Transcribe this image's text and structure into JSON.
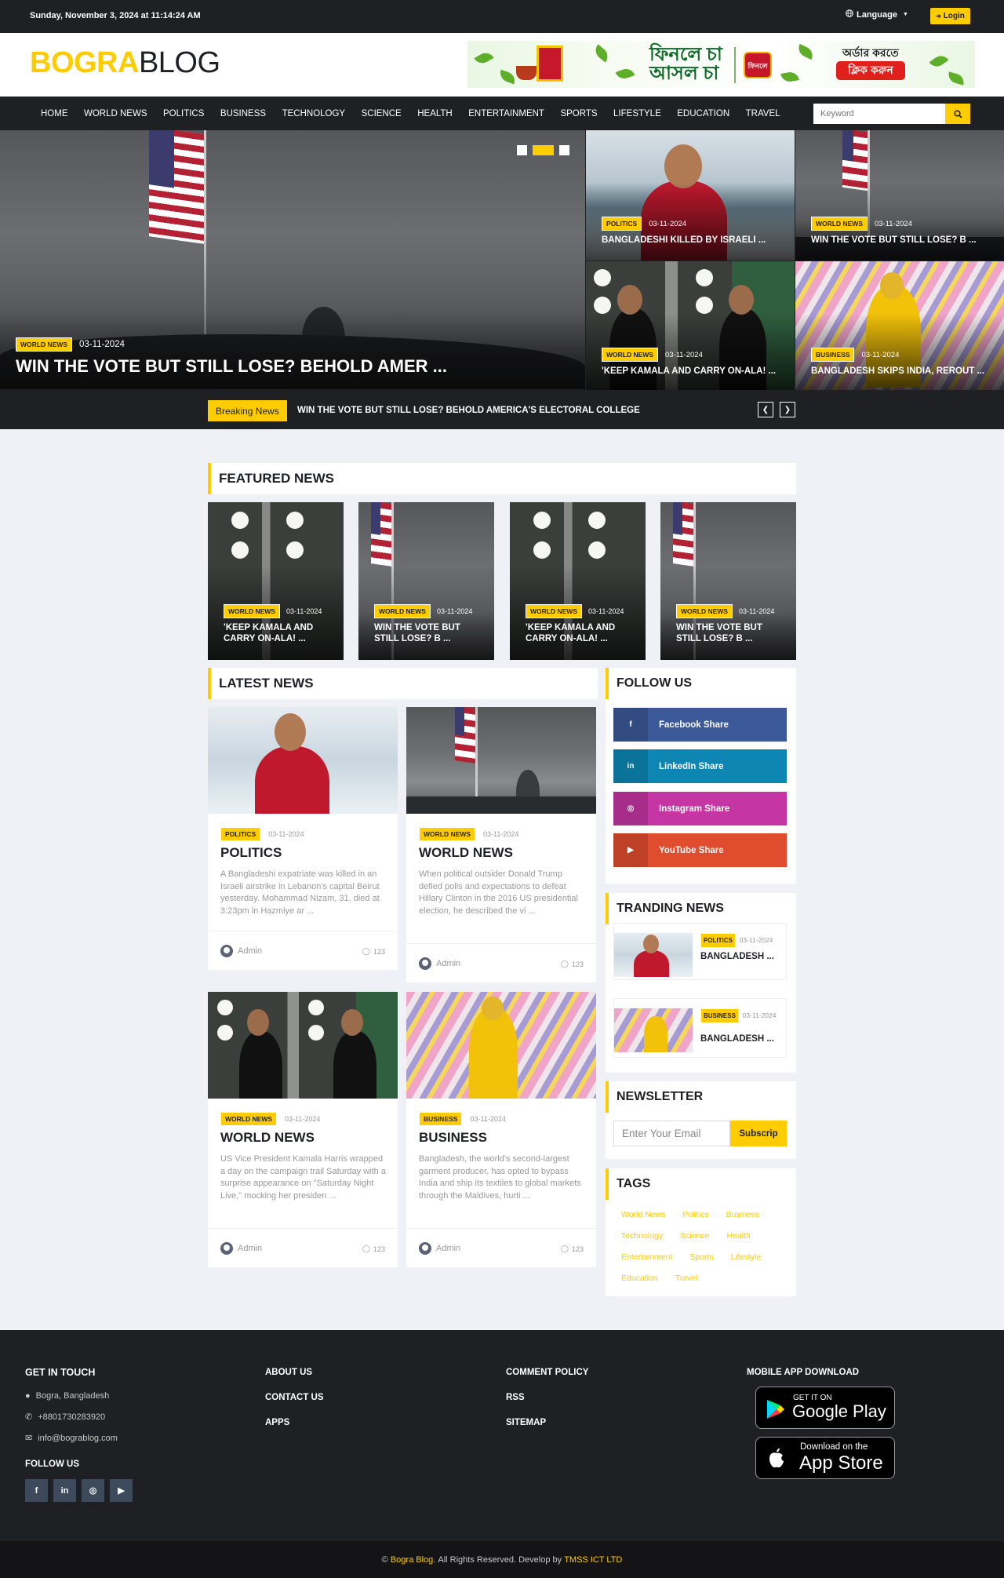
{
  "topbar": {
    "date": "Sunday, November 3, 2024 at 11:14:24 AM",
    "language": "Language",
    "login": "Login"
  },
  "header": {
    "logo_a": "BOGRA",
    "logo_b": "BLOG",
    "ad": {
      "line1": "ফিনলে চা",
      "line2": "আসল চা",
      "brand": "ফিনলে",
      "cta_top": "অর্ডার করতে",
      "cta": "ক্লিক করুন"
    }
  },
  "nav": {
    "items": [
      "HOME",
      "WORLD NEWS",
      "POLITICS",
      "BUSINESS",
      "TECHNOLOGY",
      "SCIENCE",
      "HEALTH",
      "ENTERTAINMENT",
      "SPORTS",
      "LIFESTYLE",
      "EDUCATION",
      "TRAVEL"
    ],
    "search_placeholder": "Keyword"
  },
  "hero": {
    "main": {
      "category": "WORLD NEWS",
      "date": "03-11-2024",
      "title": "WIN THE VOTE BUT STILL LOSE? BEHOLD AMER ..."
    },
    "side": [
      {
        "category": "POLITICS",
        "date": "03-11-2024",
        "title": "BANGLADESHI KILLED BY ISRAELI ..."
      },
      {
        "category": "WORLD NEWS",
        "date": "03-11-2024",
        "title": "WIN THE VOTE BUT STILL LOSE? B ..."
      },
      {
        "category": "WORLD NEWS",
        "date": "03-11-2024",
        "title": "'KEEP KAMALA AND CARRY ON-ALA! ..."
      },
      {
        "category": "BUSINESS",
        "date": "03-11-2024",
        "title": "BANGLADESH SKIPS INDIA, REROUT ..."
      }
    ],
    "breaking_label": "Breaking News",
    "breaking_text": "WIN THE VOTE BUT STILL LOSE? BEHOLD AMERICA'S ELECTORAL COLLEGE"
  },
  "featured": {
    "title": "FEATURED NEWS",
    "items": [
      {
        "category": "WORLD NEWS",
        "date": "03-11-2024",
        "title1": "'KEEP KAMALA AND",
        "title2": "CARRY ON-ALA! ..."
      },
      {
        "category": "WORLD NEWS",
        "date": "03-11-2024",
        "title1": "WIN THE VOTE BUT",
        "title2": "STILL LOSE? B ..."
      },
      {
        "category": "WORLD NEWS",
        "date": "03-11-2024",
        "title1": "'KEEP KAMALA AND",
        "title2": "CARRY ON-ALA! ..."
      },
      {
        "category": "WORLD NEWS",
        "date": "03-11-2024",
        "title1": "WIN THE VOTE BUT",
        "title2": "STILL LOSE? B ..."
      }
    ]
  },
  "latest": {
    "title": "LATEST NEWS",
    "cards": [
      {
        "category": "POLITICS",
        "date": "03-11-2024",
        "title": "POLITICS",
        "text": "A Bangladeshi expatriate was killed in an Israeli airstrike in Lebanon's capital Beirut yesterday. Mohammad Nizam, 31, died at 3:23pm in Hazmiye ar ...",
        "author": "Admin",
        "comments": "123"
      },
      {
        "category": "WORLD NEWS",
        "date": "03-11-2024",
        "title": "WORLD NEWS",
        "text": "When political outsider Donald Trump defied polls and expectations to defeat Hillary Clinton in the 2016 US presidential election, he described the vi ...",
        "author": "Admin",
        "comments": "123"
      },
      {
        "category": "WORLD NEWS",
        "date": "03-11-2024",
        "title": "WORLD NEWS",
        "text": "US Vice President Kamala Harris wrapped a day on the campaign trail Saturday with a surprise appearance on \"Saturday Night Live,\" mocking her presiden ...",
        "author": "Admin",
        "comments": "123"
      },
      {
        "category": "BUSINESS",
        "date": "03-11-2024",
        "title": "BUSINESS",
        "text": "Bangladesh, the world's second-largest garment producer, has opted to bypass India and ship its textiles to global markets through the Maldives, hurti ...",
        "author": "Admin",
        "comments": "123"
      }
    ]
  },
  "sidebar": {
    "follow_title": "FOLLOW US",
    "shares": [
      {
        "label": "Facebook Share",
        "icon": "f",
        "color": "#3b5998"
      },
      {
        "label": "LinkedIn Share",
        "icon": "in",
        "color": "#0e86b4"
      },
      {
        "label": "Instagram Share",
        "icon": "◎",
        "color": "#c536a4"
      },
      {
        "label": "YouTube Share",
        "icon": "▶",
        "color": "#e04d2e"
      }
    ],
    "trending_title": "TRANDING NEWS",
    "trending": [
      {
        "category": "POLITICS",
        "date": "03-11-2024",
        "title": "BANGLADESH ..."
      },
      {
        "category": "BUSINESS",
        "date": "03-11-2024",
        "title": "BANGLADESH ..."
      }
    ],
    "newsletter_title": "NEWSLETTER",
    "newsletter_placeholder": "Enter Your Email",
    "newsletter_button": "Subscrip",
    "tags_title": "TAGS",
    "tags": [
      "World News",
      "Politics",
      "Business",
      "Technology",
      "Science",
      "Health",
      "Entertainment",
      "Sports",
      "Lifestyle",
      "Education",
      "Travel"
    ]
  },
  "footer": {
    "get_in_touch": "GET IN TOUCH",
    "location": "Bogra, Bangladesh",
    "phone": "+8801730283920",
    "email": "info@bograblog.com",
    "follow_us": "FOLLOW US",
    "links_col1": [
      "ABOUT US",
      "CONTACT US",
      "APPS"
    ],
    "links_col2": [
      "COMMENT POLICY",
      "RSS",
      "SITEMAP"
    ],
    "app_title": "MOBILE APP DOWNLOAD",
    "google_small": "GET IT ON",
    "google_big": "Google Play",
    "apple_small": "Download on the",
    "apple_big": "App Store",
    "copy_prefix": "©",
    "copy_site": "Bogra Blog.",
    "copy_mid": "All Rights Reserved. Develop by",
    "copy_dev": "TMSS ICT LTD"
  },
  "colors": {
    "accent": "#ffcc00",
    "dark": "#1e2024",
    "body_bg": "#f0f1f6"
  }
}
